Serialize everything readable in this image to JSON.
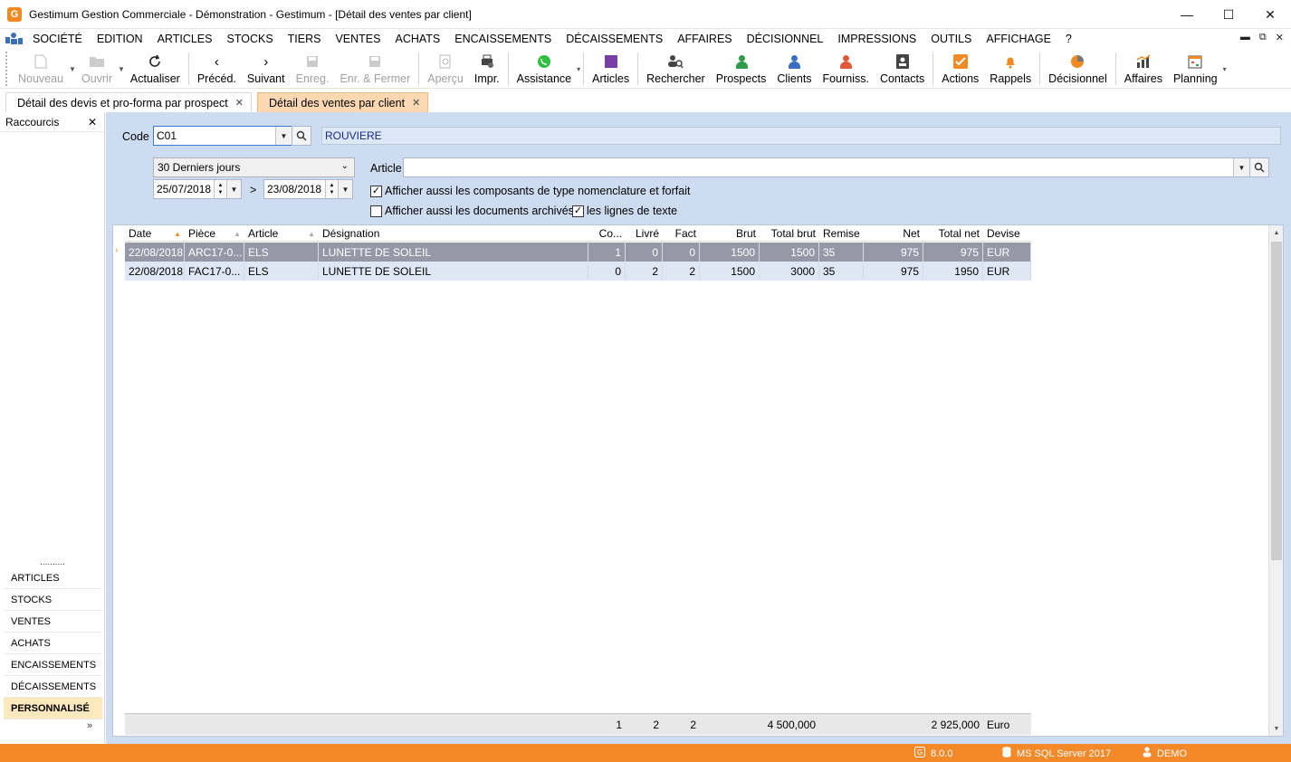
{
  "window": {
    "title": "Gestimum Gestion Commerciale - Démonstration - Gestimum - [Détail des ventes par client]",
    "logo_letter": "G",
    "minimize": "—",
    "maximize": "☐",
    "close": "✕"
  },
  "menu": {
    "items": [
      "SOCIÉTÉ",
      "EDITION",
      "ARTICLES",
      "STOCKS",
      "TIERS",
      "VENTES",
      "ACHATS",
      "ENCAISSEMENTS",
      "DÉCAISSEMENTS",
      "AFFAIRES",
      "DÉCISIONNEL",
      "IMPRESSIONS",
      "OUTILS",
      "AFFICHAGE",
      "?"
    ],
    "right_controls": [
      "▬",
      "⧉",
      "✕"
    ]
  },
  "toolbar": {
    "nouveau": "Nouveau",
    "ouvrir": "Ouvrir",
    "actualiser": "Actualiser",
    "preced": "Précéd.",
    "suivant": "Suivant",
    "enreg": "Enreg.",
    "enr_fermer": "Enr. & Fermer",
    "apercu": "Aperçu",
    "impr": "Impr.",
    "assistance": "Assistance",
    "articles": "Articles",
    "rechercher": "Rechercher",
    "prospects": "Prospects",
    "clients": "Clients",
    "fourniss": "Fourniss.",
    "contacts": "Contacts",
    "actions": "Actions",
    "rappels": "Rappels",
    "decisionnel": "Décisionnel",
    "affaires": "Affaires",
    "planning": "Planning"
  },
  "tabs": [
    {
      "label": "Détail des devis et pro-forma par prospect",
      "close": "✕"
    },
    {
      "label": "Détail des ventes par client",
      "close": "✕"
    }
  ],
  "sidebar": {
    "title": "Raccourcis",
    "close": "✕",
    "dots": "..........",
    "items": [
      "ARTICLES",
      "STOCKS",
      "VENTES",
      "ACHATS",
      "ENCAISSEMENTS",
      "DÉCAISSEMENTS",
      "PERSONNALISÉ"
    ],
    "more": "»"
  },
  "filters": {
    "code_label": "Code",
    "code_value": "C01",
    "client_name": "ROUVIERE",
    "period": "30 Derniers jours",
    "date_from": "25/07/2018",
    "date_sep": ">",
    "date_to": "23/08/2018",
    "article_label": "Article",
    "article_value": "",
    "chk_composants": "Afficher aussi les composants de type nomenclature et forfait",
    "chk_archives": "Afficher aussi les documents archivés",
    "chk_lignes": "les lignes de texte",
    "chk_composants_checked": true,
    "chk_archives_checked": false,
    "chk_lignes_checked": true
  },
  "grid": {
    "columns": [
      "Date",
      "Pièce",
      "Article",
      "Désignation",
      "Co...",
      "Livré",
      "Fact",
      "Brut",
      "Total brut",
      "Remise",
      "Net",
      "Total net",
      "Devise"
    ],
    "rows": [
      {
        "date": "22/08/2018",
        "piece": "ARC17-0...",
        "article": "ELS",
        "designation": "LUNETTE DE SOLEIL",
        "co": "1",
        "livre": "0",
        "fact": "0",
        "brut": "1500",
        "total_brut": "1500",
        "remise": "35",
        "net": "975",
        "total_net": "975",
        "devise": "EUR"
      },
      {
        "date": "22/08/2018",
        "piece": "FAC17-0...",
        "article": "ELS",
        "designation": "LUNETTE DE SOLEIL",
        "co": "0",
        "livre": "2",
        "fact": "2",
        "brut": "1500",
        "total_brut": "3000",
        "remise": "35",
        "net": "975",
        "total_net": "1950",
        "devise": "EUR"
      }
    ],
    "footer": {
      "co": "1",
      "livre": "2",
      "fact": "2",
      "total_brut": "4 500,000",
      "total_net": "2 925,000",
      "devise": "Euro"
    },
    "selected_indicator": "›"
  },
  "status": {
    "version": "8.0.0",
    "server": "MS SQL Server 2017",
    "user": "DEMO"
  },
  "colors": {
    "accent": "#f4892a",
    "content_bg": "#cddcf0",
    "selected_row": "#9698a8"
  }
}
